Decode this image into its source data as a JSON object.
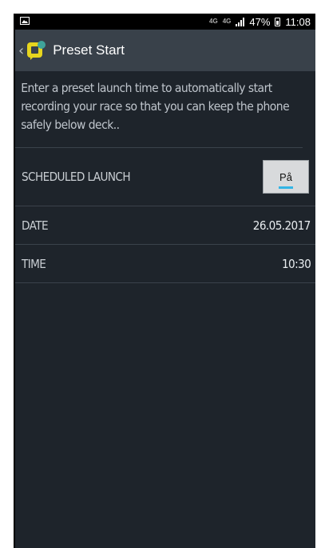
{
  "status_bar": {
    "network_1": "4G",
    "network_2": "4G",
    "battery": "47%",
    "time": "11:08"
  },
  "app_bar": {
    "back_icon": "chevron-left-icon",
    "logo_icon": "app-logo-icon",
    "title": "Preset Start"
  },
  "description": "Enter a preset launch time to automatically start recording your race so that you can keep the phone safely below deck..",
  "settings": {
    "scheduled_launch": {
      "label": "SCHEDULED LAUNCH",
      "toggle_label": "På"
    },
    "date": {
      "label": "DATE",
      "value": "26.05.2017"
    },
    "time": {
      "label": "TIME",
      "value": "10:30"
    }
  },
  "colors": {
    "background": "#1e242b",
    "app_bar": "#39414a",
    "toggle_accent": "#33b5e5",
    "logo_yellow": "#e7d51e",
    "logo_teal": "#3fa39a"
  }
}
